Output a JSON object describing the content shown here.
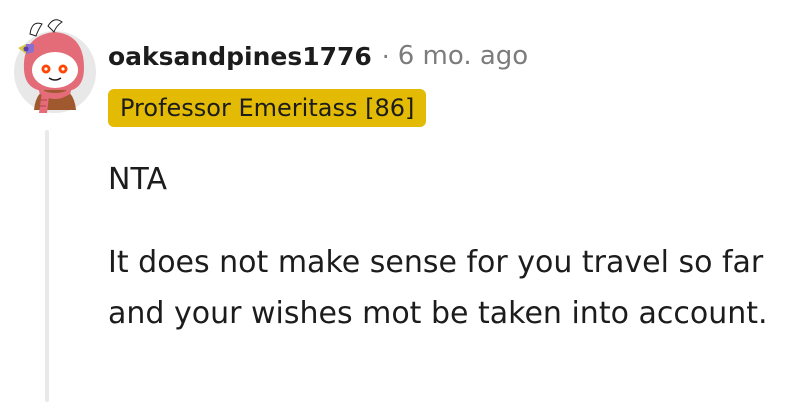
{
  "comment": {
    "avatar_icon": "snoo-avatar-icon",
    "username": "oaksandpines1776",
    "separator": "·",
    "timestamp": "6 mo. ago",
    "flair": "Professor Emeritass [86]",
    "flair_color": "#e3bb04",
    "paragraphs": [
      "NTA",
      "It does not make sense for you travel so far and your wishes mot be taken into account."
    ]
  }
}
